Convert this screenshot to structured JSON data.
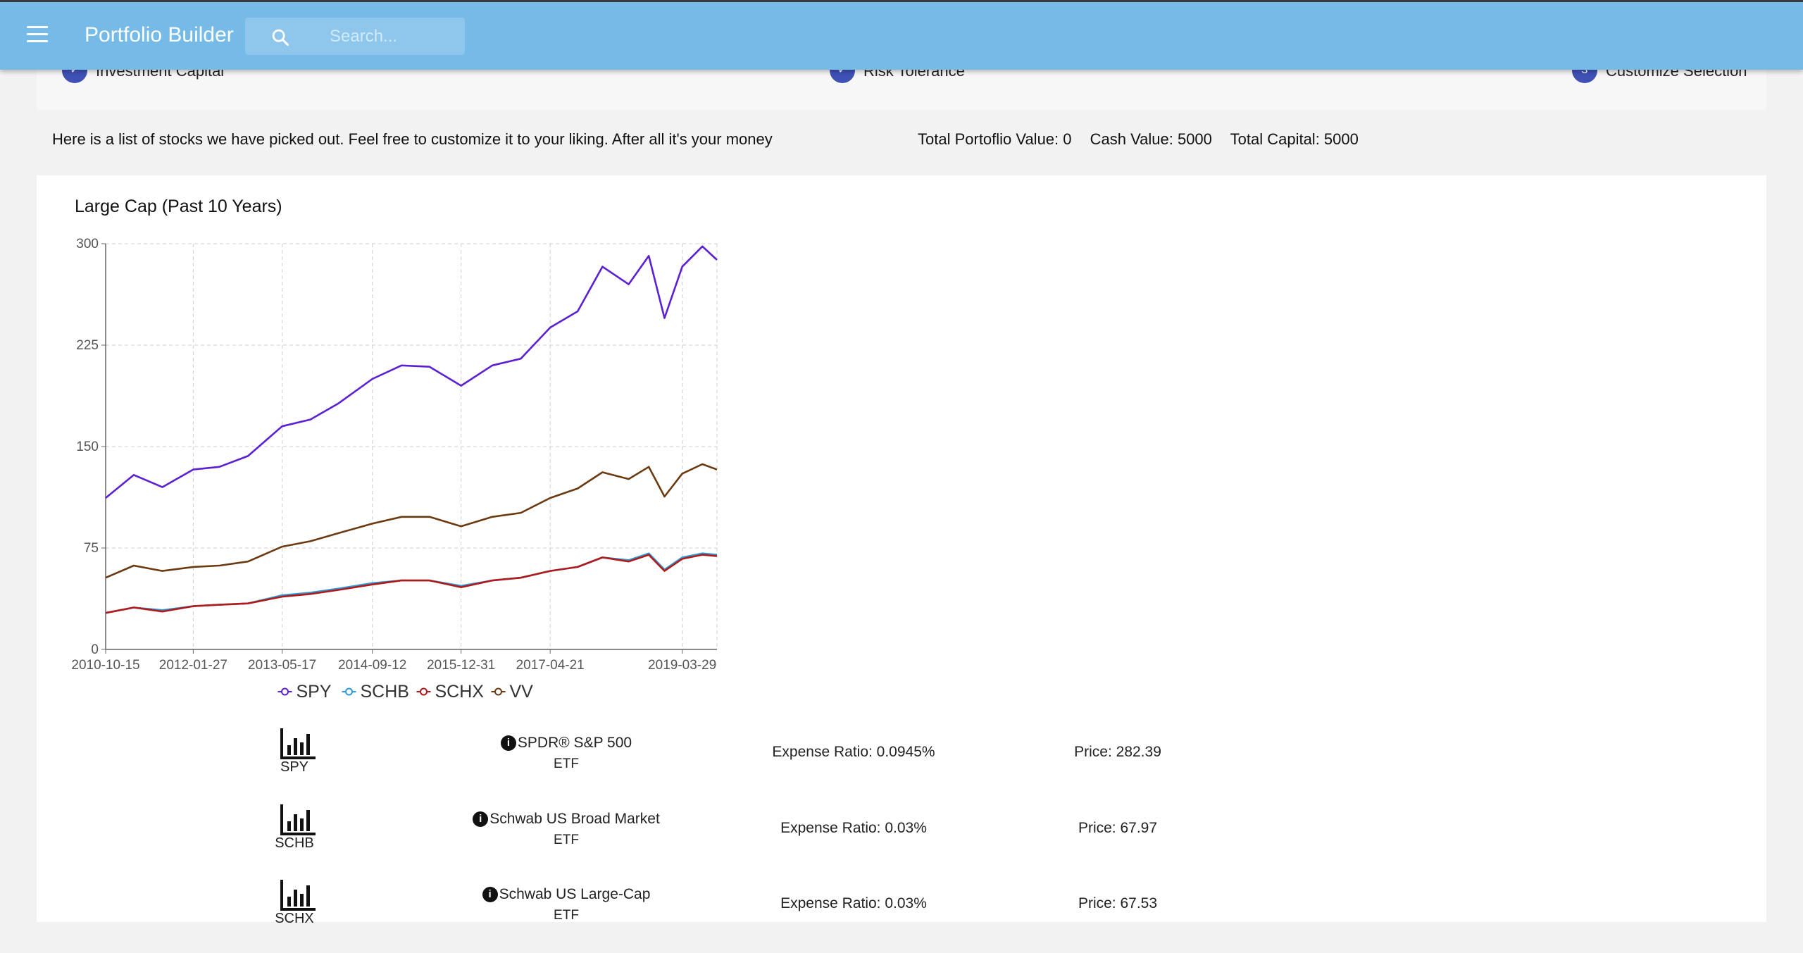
{
  "app": {
    "title": "Portfolio Builder"
  },
  "search": {
    "placeholder": "Search..."
  },
  "steps": [
    {
      "label": "Investment Capital",
      "status": "done"
    },
    {
      "label": "Risk Tolerance",
      "status": "done"
    },
    {
      "label": "Customize Selection",
      "number": "3",
      "status": "active"
    }
  ],
  "intro": "Here is a list of stocks we have picked out. Feel free to customize it to your liking. After all it's your money",
  "stats": {
    "portfolio_value": "Total Portoflio Value: 0",
    "cash_value": "Cash Value: 5000",
    "total_capital": "Total Capital: 5000"
  },
  "chart_data": {
    "type": "line",
    "title": "Large Cap (Past 10 Years)",
    "xlabel": "",
    "ylabel": "",
    "x": [
      "2010-10-15",
      "2011-03-15",
      "2011-08-15",
      "2012-01-27",
      "2012-06-15",
      "2012-11-15",
      "2013-05-17",
      "2013-10-15",
      "2014-03-15",
      "2014-09-12",
      "2015-02-15",
      "2015-07-15",
      "2015-12-31",
      "2016-06-15",
      "2016-11-15",
      "2017-04-21",
      "2017-09-15",
      "2018-01-26",
      "2018-06-15",
      "2018-10-01",
      "2018-12-24",
      "2019-03-29",
      "2019-07-15",
      "2019-10-01"
    ],
    "x_ticks": [
      "2010-10-15",
      "2012-01-27",
      "2013-05-17",
      "2014-09-12",
      "2015-12-31",
      "2017-04-21",
      "2019-03-29"
    ],
    "y_ticks": [
      0,
      75,
      150,
      225,
      300
    ],
    "ylim": [
      0,
      300
    ],
    "grid": true,
    "legend_position": "bottom",
    "series": [
      {
        "name": "SPY",
        "color": "#5b20d4",
        "values": [
          112,
          129,
          120,
          133,
          135,
          143,
          165,
          170,
          182,
          200,
          210,
          209,
          195,
          210,
          215,
          238,
          250,
          283,
          270,
          291,
          245,
          283,
          298,
          288
        ]
      },
      {
        "name": "SCHB",
        "color": "#2e9bd6",
        "values": [
          27,
          31,
          29,
          32,
          33,
          34,
          40,
          42,
          45,
          49,
          51,
          51,
          47,
          51,
          53,
          58,
          61,
          68,
          66,
          71,
          59,
          68,
          71,
          70
        ]
      },
      {
        "name": "SCHX",
        "color": "#b11a1a",
        "values": [
          27,
          31,
          28,
          32,
          33,
          34,
          39,
          41,
          44,
          48,
          51,
          51,
          46,
          51,
          53,
          58,
          61,
          68,
          65,
          70,
          58,
          67,
          70,
          69
        ]
      },
      {
        "name": "VV",
        "color": "#6b3a10",
        "values": [
          53,
          62,
          58,
          61,
          62,
          65,
          76,
          80,
          86,
          93,
          98,
          98,
          91,
          98,
          101,
          112,
          119,
          131,
          126,
          135,
          113,
          130,
          137,
          133
        ]
      }
    ]
  },
  "funds": [
    {
      "symbol": "SPY",
      "name": "SPDR® S&P 500",
      "type": "ETF",
      "expense": "Expense Ratio: 0.0945%",
      "price": "Price: 282.39"
    },
    {
      "symbol": "SCHB",
      "name": "Schwab US Broad Market",
      "type": "ETF",
      "expense": "Expense Ratio: 0.03%",
      "price": "Price: 67.97"
    },
    {
      "symbol": "SCHX",
      "name": "Schwab US Large-Cap",
      "type": "ETF",
      "expense": "Expense Ratio: 0.03%",
      "price": "Price: 67.53"
    }
  ],
  "icons": {
    "menu": "menu-icon",
    "search": "search-icon",
    "check": "check-icon",
    "chart": "bar-chart-icon",
    "info": "info-icon"
  }
}
